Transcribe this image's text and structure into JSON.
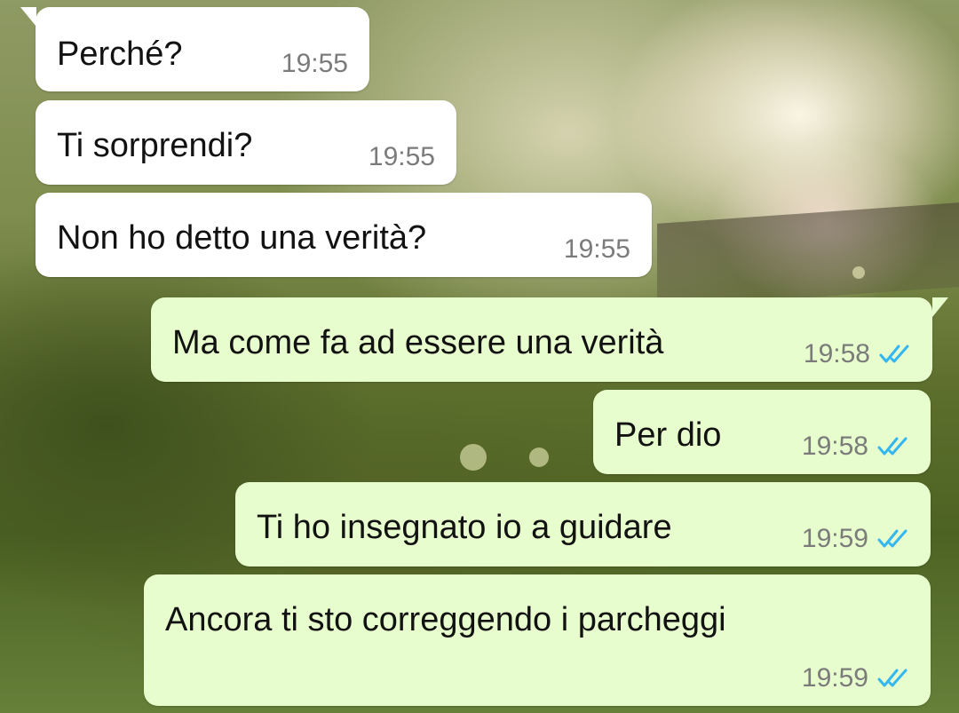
{
  "chat": {
    "background": {
      "description_colors": {
        "foliage": "#5c6e2c",
        "sunlight": "#fff8e6"
      }
    },
    "incoming_bubble_color": "#ffffff",
    "outgoing_bubble_color": "#e7fdcd",
    "read_tick_color": "#34b7f1",
    "messages": [
      {
        "direction": "incoming",
        "text": "Perché?",
        "time": "19:55"
      },
      {
        "direction": "incoming",
        "text": "Ti sorprendi?",
        "time": "19:55"
      },
      {
        "direction": "incoming",
        "text": "Non ho detto una verità?",
        "time": "19:55"
      },
      {
        "direction": "outgoing",
        "text": "Ma come fa ad essere una verità",
        "time": "19:58",
        "status_icon": "double-check-read-icon"
      },
      {
        "direction": "outgoing",
        "text": "Per dio",
        "time": "19:58",
        "status_icon": "double-check-read-icon"
      },
      {
        "direction": "outgoing",
        "text": "Ti ho insegnato io a guidare",
        "time": "19:59",
        "status_icon": "double-check-read-icon"
      },
      {
        "direction": "outgoing",
        "text": "Ancora ti sto correggendo i parcheggi",
        "time": "19:59",
        "status_icon": "double-check-read-icon"
      }
    ]
  }
}
